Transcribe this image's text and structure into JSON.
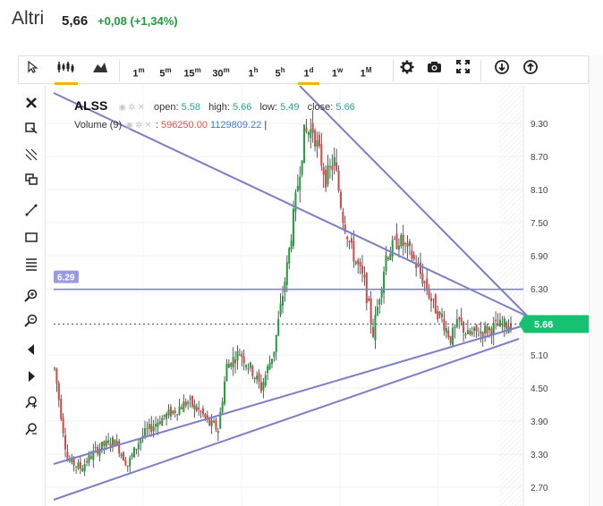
{
  "header": {
    "ticker": "Altri",
    "price": "5,66",
    "change": "+0,08 (+1,34%)"
  },
  "toolbar": {
    "intervals": [
      {
        "base": "1",
        "sup": "m"
      },
      {
        "base": "5",
        "sup": "m"
      },
      {
        "base": "15",
        "sup": "m"
      },
      {
        "base": "30",
        "sup": "m"
      },
      {
        "base": "1",
        "sup": "h"
      },
      {
        "base": "5",
        "sup": "h"
      },
      {
        "base": "1",
        "sup": "d"
      },
      {
        "base": "1",
        "sup": "w"
      },
      {
        "base": "1",
        "sup": "M"
      }
    ],
    "active_interval": "1d"
  },
  "legend": {
    "symbol": "ALSS",
    "open_label": "open:",
    "open_value": "5.58",
    "high_label": "high:",
    "high_value": "5.66",
    "low_label": "low:",
    "low_value": "5.49",
    "close_label": "close:",
    "close_value": "5.66",
    "volume_label": "Volume (9)",
    "volume_value1": "596250.00",
    "volume_value2": "1129809.22",
    "cursor": "|"
  },
  "chart_data": {
    "type": "candlestick",
    "y_ticks": [
      "9.30",
      "8.70",
      "8.10",
      "7.50",
      "6.90",
      "6.30",
      "5.10",
      "4.50",
      "3.90",
      "3.30",
      "2.70"
    ],
    "ylim": [
      2.55,
      9.75
    ],
    "last_price_label": "5.66",
    "last_price": 5.66,
    "horizontal_level_label": "6.29",
    "horizontal_level": 6.29,
    "colors": {
      "up": "#1f9d3d",
      "down": "#d64545",
      "drawing": "#7e7ec6",
      "price_tag": "#16c172",
      "level_tag": "#9a9ae0"
    },
    "series_key_points": [
      [
        0,
        4.85
      ],
      [
        6,
        3.2
      ],
      [
        12,
        3.05
      ],
      [
        20,
        3.4
      ],
      [
        28,
        3.55
      ],
      [
        34,
        3.1
      ],
      [
        40,
        3.6
      ],
      [
        48,
        3.9
      ],
      [
        56,
        4.1
      ],
      [
        62,
        4.25
      ],
      [
        68,
        4.05
      ],
      [
        72,
        3.85
      ],
      [
        76,
        3.75
      ],
      [
        80,
        4.9
      ],
      [
        86,
        5.15
      ],
      [
        92,
        4.8
      ],
      [
        96,
        4.5
      ],
      [
        102,
        5.2
      ],
      [
        108,
        6.7
      ],
      [
        112,
        7.9
      ],
      [
        116,
        9.1
      ],
      [
        120,
        9.2
      ],
      [
        126,
        8.3
      ],
      [
        130,
        8.6
      ],
      [
        134,
        7.6
      ],
      [
        138,
        7.0
      ],
      [
        144,
        6.4
      ],
      [
        148,
        5.5
      ],
      [
        154,
        6.9
      ],
      [
        160,
        7.2
      ],
      [
        166,
        6.9
      ],
      [
        172,
        6.4
      ],
      [
        176,
        6.0
      ],
      [
        180,
        5.75
      ],
      [
        184,
        5.4
      ],
      [
        188,
        5.7
      ],
      [
        192,
        5.45
      ],
      [
        196,
        5.5
      ],
      [
        200,
        5.55
      ],
      [
        206,
        5.62
      ],
      [
        212,
        5.66
      ]
    ],
    "grid": true
  },
  "left_tools": [
    "close-icon",
    "measure-icon",
    "line-tools-icon",
    "group-icon",
    "trendline-icon",
    "rectangle-icon",
    "fibonacci-icon",
    "zoom-in-icon",
    "zoom-out-icon",
    "scroll-left-icon",
    "scroll-right-icon",
    "magnet-icon",
    "remove-drawings-icon"
  ]
}
